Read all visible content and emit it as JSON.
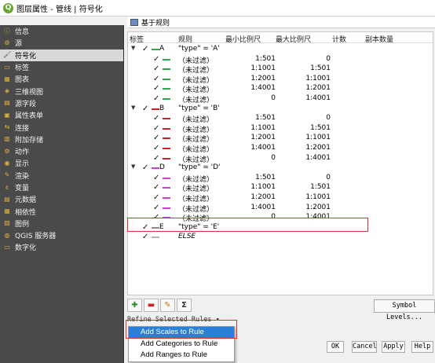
{
  "window": {
    "title": "图层属性 - 管线 | 符号化",
    "icon": "qgis-icon"
  },
  "sidebar": {
    "items": [
      {
        "label": "信息",
        "icon": "info-icon",
        "active": false
      },
      {
        "label": "源",
        "icon": "source-icon",
        "active": false
      },
      {
        "label": "符号化",
        "icon": "symbology-icon",
        "active": true
      },
      {
        "label": "标签",
        "icon": "labels-icon",
        "active": false
      },
      {
        "label": "图表",
        "icon": "diagrams-icon",
        "active": false
      },
      {
        "label": "三维视图",
        "icon": "3d-view-icon",
        "active": false
      },
      {
        "label": "源字段",
        "icon": "fields-icon",
        "active": false
      },
      {
        "label": "属性表单",
        "icon": "attributes-form-icon",
        "active": false
      },
      {
        "label": "连接",
        "icon": "joins-icon",
        "active": false
      },
      {
        "label": "附加存储",
        "icon": "auxiliary-storage-icon",
        "active": false
      },
      {
        "label": "动作",
        "icon": "actions-icon",
        "active": false
      },
      {
        "label": "显示",
        "icon": "display-icon",
        "active": false
      },
      {
        "label": "渲染",
        "icon": "rendering-icon",
        "active": false
      },
      {
        "label": "变量",
        "icon": "variables-icon",
        "active": false
      },
      {
        "label": "元数据",
        "icon": "metadata-icon",
        "active": false
      },
      {
        "label": "相依性",
        "icon": "dependencies-icon",
        "active": false
      },
      {
        "label": "图例",
        "icon": "legend-icon",
        "active": false
      },
      {
        "label": "QGIS 服务器",
        "icon": "qgis-server-icon",
        "active": false
      },
      {
        "label": "数字化",
        "icon": "digitizing-icon",
        "active": false
      }
    ]
  },
  "renderer": {
    "label": "基于规则"
  },
  "tree": {
    "headers": [
      "标签",
      "规则",
      "最小比例尺",
      "最大比例尺",
      "计数",
      "副本数量"
    ],
    "rows": [
      {
        "type": "group",
        "label": "A",
        "rule": "\"type\" = 'A'",
        "min": "",
        "max": "",
        "color": "#2aa846"
      },
      {
        "type": "child",
        "label": "",
        "rule": "（未过滤）",
        "min": "1:501",
        "max": "0",
        "color": "#2aa846"
      },
      {
        "type": "child",
        "label": "",
        "rule": "（未过滤）",
        "min": "1:1001",
        "max": "1:501",
        "color": "#2aa846"
      },
      {
        "type": "child",
        "label": "",
        "rule": "（未过滤）",
        "min": "1:2001",
        "max": "1:1001",
        "color": "#2aa846"
      },
      {
        "type": "child",
        "label": "",
        "rule": "（未过滤）",
        "min": "1:4001",
        "max": "1:2001",
        "color": "#2aa846"
      },
      {
        "type": "child",
        "label": "",
        "rule": "（未过滤）",
        "min": "0",
        "max": "1:4001",
        "color": "#2aa846"
      },
      {
        "type": "group",
        "label": "B",
        "rule": "\"type\" = 'B'",
        "min": "",
        "max": "",
        "color": "#c8202a"
      },
      {
        "type": "child",
        "label": "",
        "rule": "（未过滤）",
        "min": "1:501",
        "max": "0",
        "color": "#c8202a"
      },
      {
        "type": "child",
        "label": "",
        "rule": "（未过滤）",
        "min": "1:1001",
        "max": "1:501",
        "color": "#c8202a"
      },
      {
        "type": "child",
        "label": "",
        "rule": "（未过滤）",
        "min": "1:2001",
        "max": "1:1001",
        "color": "#c8202a"
      },
      {
        "type": "child",
        "label": "",
        "rule": "（未过滤）",
        "min": "1:4001",
        "max": "1:2001",
        "color": "#c8202a"
      },
      {
        "type": "child",
        "label": "",
        "rule": "（未过滤）",
        "min": "0",
        "max": "1:4001",
        "color": "#c8202a"
      },
      {
        "type": "group",
        "label": "D",
        "rule": "\"type\" = 'D'",
        "min": "",
        "max": "",
        "color": "#d23ad6"
      },
      {
        "type": "child",
        "label": "",
        "rule": "（未过滤）",
        "min": "1:501",
        "max": "0",
        "color": "#d23ad6"
      },
      {
        "type": "child",
        "label": "",
        "rule": "（未过滤）",
        "min": "1:1001",
        "max": "1:501",
        "color": "#d23ad6"
      },
      {
        "type": "child",
        "label": "",
        "rule": "（未过滤）",
        "min": "1:2001",
        "max": "1:1001",
        "color": "#d23ad6"
      },
      {
        "type": "child",
        "label": "",
        "rule": "（未过滤）",
        "min": "1:4001",
        "max": "1:2001",
        "color": "#d23ad6"
      },
      {
        "type": "child",
        "label": "",
        "rule": "（未过滤）",
        "min": "0",
        "max": "1:4001",
        "color": "#d23ad6"
      },
      {
        "type": "leaf",
        "label": "E",
        "rule": "\"type\" = 'E'",
        "min": "",
        "max": "",
        "color": "#8a8a8a"
      },
      {
        "type": "leaf",
        "label": "",
        "rule": "ELSE",
        "min": "",
        "max": "",
        "color": "#b0b0b0",
        "italic": true
      }
    ]
  },
  "toolbar": {
    "buttons": [
      {
        "icon": "add-rule-icon"
      },
      {
        "icon": "remove-rule-icon"
      },
      {
        "icon": "edit-rule-icon"
      },
      {
        "icon": "sum-icon"
      }
    ],
    "symbol_levels": "Symbol Levels..."
  },
  "refine": {
    "label": "Refine Selected Rules ▾"
  },
  "menu": {
    "items": [
      "Add Scales to Rule",
      "Add Categories to Rule",
      "Add Ranges to Rule"
    ],
    "selected_index": 0
  },
  "dialog_buttons": {
    "ok": "OK",
    "cancel": "Cancel",
    "apply": "Apply",
    "help": "Help"
  }
}
